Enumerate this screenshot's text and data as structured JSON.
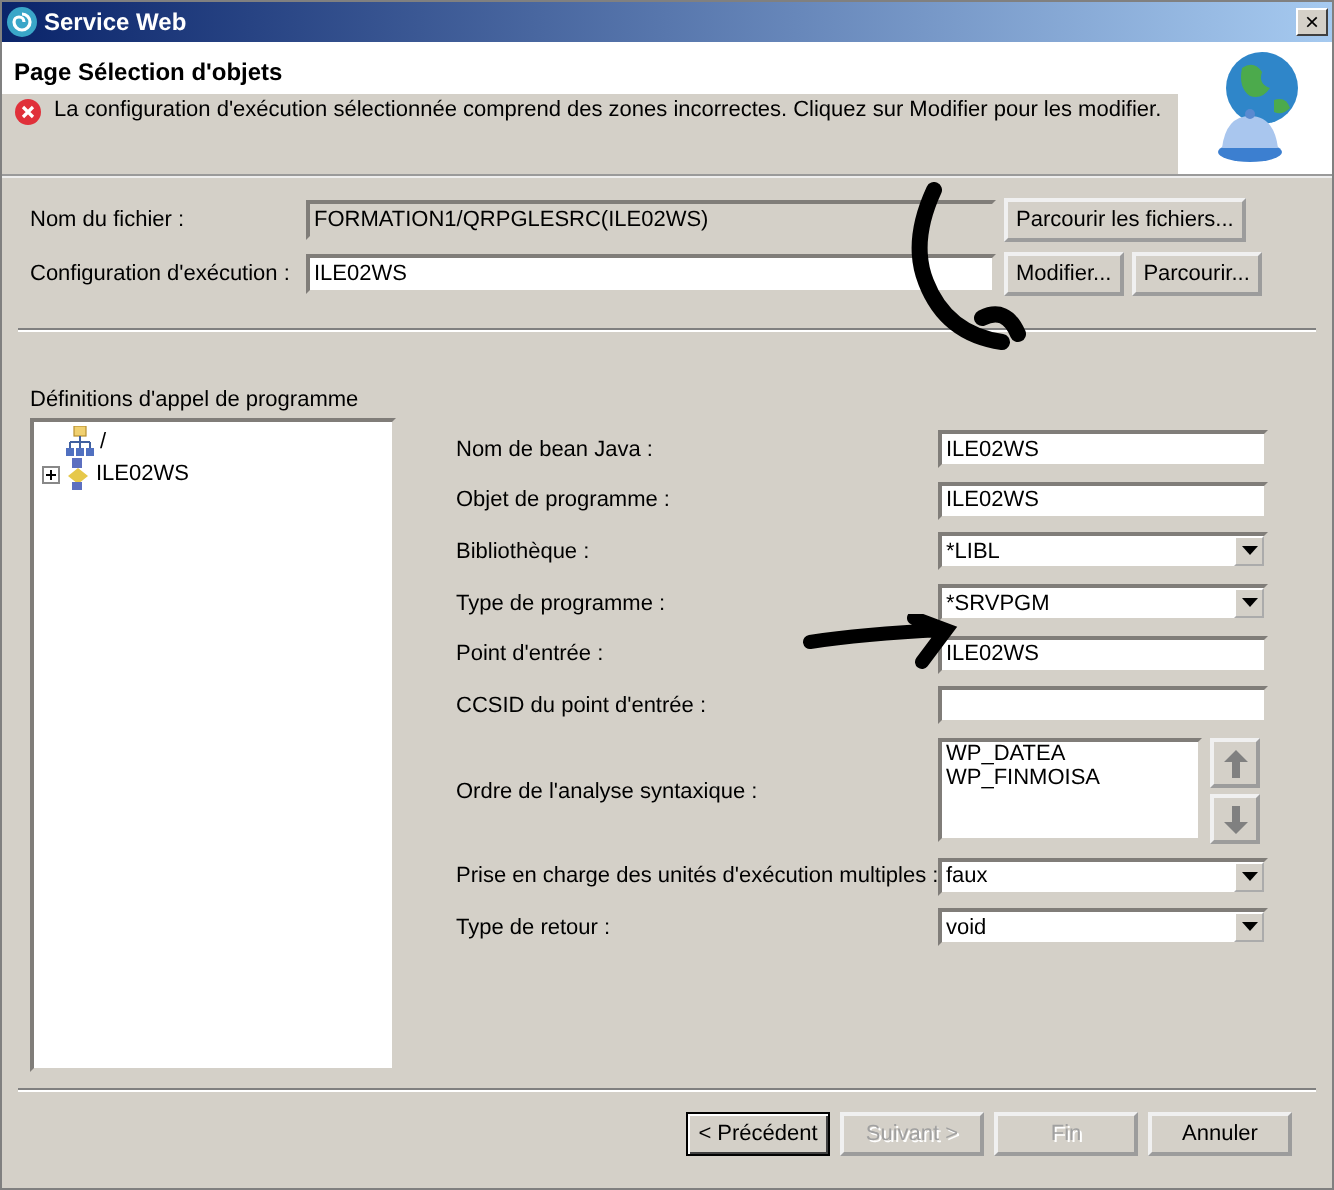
{
  "window": {
    "title": "Service Web",
    "close": "×"
  },
  "header": {
    "title": "Page Sélection d'objets",
    "message": "La configuration d'exécution sélectionnée comprend des zones incorrectes. Cliquez sur Modifier pour  les modifier."
  },
  "top_fields": [
    {
      "label": "Nom du fichier :",
      "value": "FORMATION1/QRPGLESRC(ILE02WS)",
      "disabled": true,
      "buttons": [
        "Parcourir les fichiers..."
      ]
    },
    {
      "label": "Configuration d'exécution :",
      "value": "ILE02WS",
      "disabled": false,
      "buttons": [
        "Modifier...",
        "Parcourir..."
      ]
    }
  ],
  "tree": {
    "label": "Définitions d'appel de programme",
    "items": [
      {
        "label": "/",
        "kind": "root"
      },
      {
        "label": "ILE02WS",
        "kind": "program",
        "expanded": false
      }
    ]
  },
  "properties": [
    {
      "label": "Nom de bean Java :",
      "kind": "text",
      "value": "ILE02WS"
    },
    {
      "label": "Objet de programme :",
      "kind": "text",
      "value": "ILE02WS"
    },
    {
      "label": "Bibliothèque :",
      "kind": "combo",
      "value": "*LIBL"
    },
    {
      "label": "Type de programme :",
      "kind": "combo",
      "value": "*SRVPGM"
    },
    {
      "label": "Point d'entrée :",
      "kind": "text",
      "value": "ILE02WS"
    },
    {
      "label": "CCSID du point d'entrée :",
      "kind": "text"
    },
    {
      "label": "Ordre de l'analyse syntaxique :",
      "kind": "list",
      "items": [
        "WP_DATEA",
        "WP_FINMOISA"
      ]
    },
    {
      "label": "Prise en charge des unités d'exécution multiples :",
      "kind": "combo",
      "value": "faux"
    },
    {
      "label": "Type de retour :",
      "kind": "combo",
      "value": "void"
    }
  ],
  "buttons": [
    {
      "label": "< Précédent",
      "disabled": false,
      "default": true
    },
    {
      "label": "Suivant >",
      "disabled": true,
      "default": false
    },
    {
      "label": "Fin",
      "disabled": true,
      "default": false
    },
    {
      "label": "Annuler",
      "disabled": false,
      "default": false
    }
  ]
}
